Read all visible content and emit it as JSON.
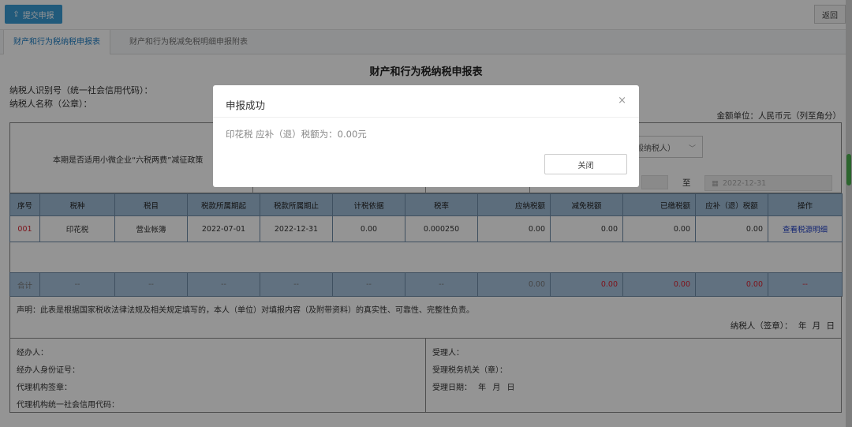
{
  "toolbar": {
    "submit_label": "提交申报",
    "return_label": "返回"
  },
  "tabs": [
    {
      "label": "财产和行为税纳税申报表",
      "active": true
    },
    {
      "label": "财产和行为税减免税明细申报附表",
      "active": false
    }
  ],
  "form": {
    "title": "财产和行为税纳税申报表",
    "taxpayer_id_label": "纳税人识别号（统一社会信用代码）：",
    "taxpayer_name_label": "纳税人名称（公章）：",
    "unit_label": "金额单位：人民币元（列至角分）",
    "policy_label": "本期是否适用小微企业“六税两费”减征政策",
    "taxpayer_type_select": "般纳税人）",
    "period_to_label": "至",
    "period_end": "2022-12-31"
  },
  "table": {
    "headers": [
      "序号",
      "税种",
      "税目",
      "税款所属期起",
      "税款所属期止",
      "计税依据",
      "税率",
      "应纳税额",
      "减免税额",
      "已缴税额",
      "应补（退）税额",
      "操作"
    ],
    "rows": [
      {
        "no": "001",
        "tax_type": "印花税",
        "item": "营业帐簿",
        "period_start": "2022-07-01",
        "period_end": "2022-12-31",
        "basis": "0.00",
        "rate": "0.000250",
        "payable": "0.00",
        "reduced": "0.00",
        "paid": "0.00",
        "due": "0.00",
        "action": "查看税源明细"
      }
    ],
    "total": {
      "label": "合计",
      "dash": "--",
      "payable": "0.00",
      "reduced": "0.00",
      "paid": "0.00",
      "due": "0.00",
      "action": "--"
    }
  },
  "declaration": {
    "text": "声明：此表是根据国家税收法律法规及相关规定填写的，本人（单位）对填报内容（及附带资料）的真实性、可靠性、完整性负责。",
    "sign": "纳税人（签章）：  年  月  日"
  },
  "bottom": {
    "agent": "经办人：",
    "agent_id": "经办人身份证号：",
    "agency_seal": "代理机构签章：",
    "agency_code": "代理机构统一社会信用代码：",
    "receiver": "受理人：",
    "receiving_office": "受理税务机关（章）：",
    "receive_date": "受理日期：  年  月  日"
  },
  "modal": {
    "title": "申报成功",
    "message": "印花税 应补（退）税额为：0.00元",
    "close_button": "关闭",
    "close_icon": "×"
  },
  "colors": {
    "primary": "#3a9bd5",
    "header_bg": "#9fbcd6",
    "total_bg": "#a8c3dc",
    "red": "#d9232f"
  }
}
